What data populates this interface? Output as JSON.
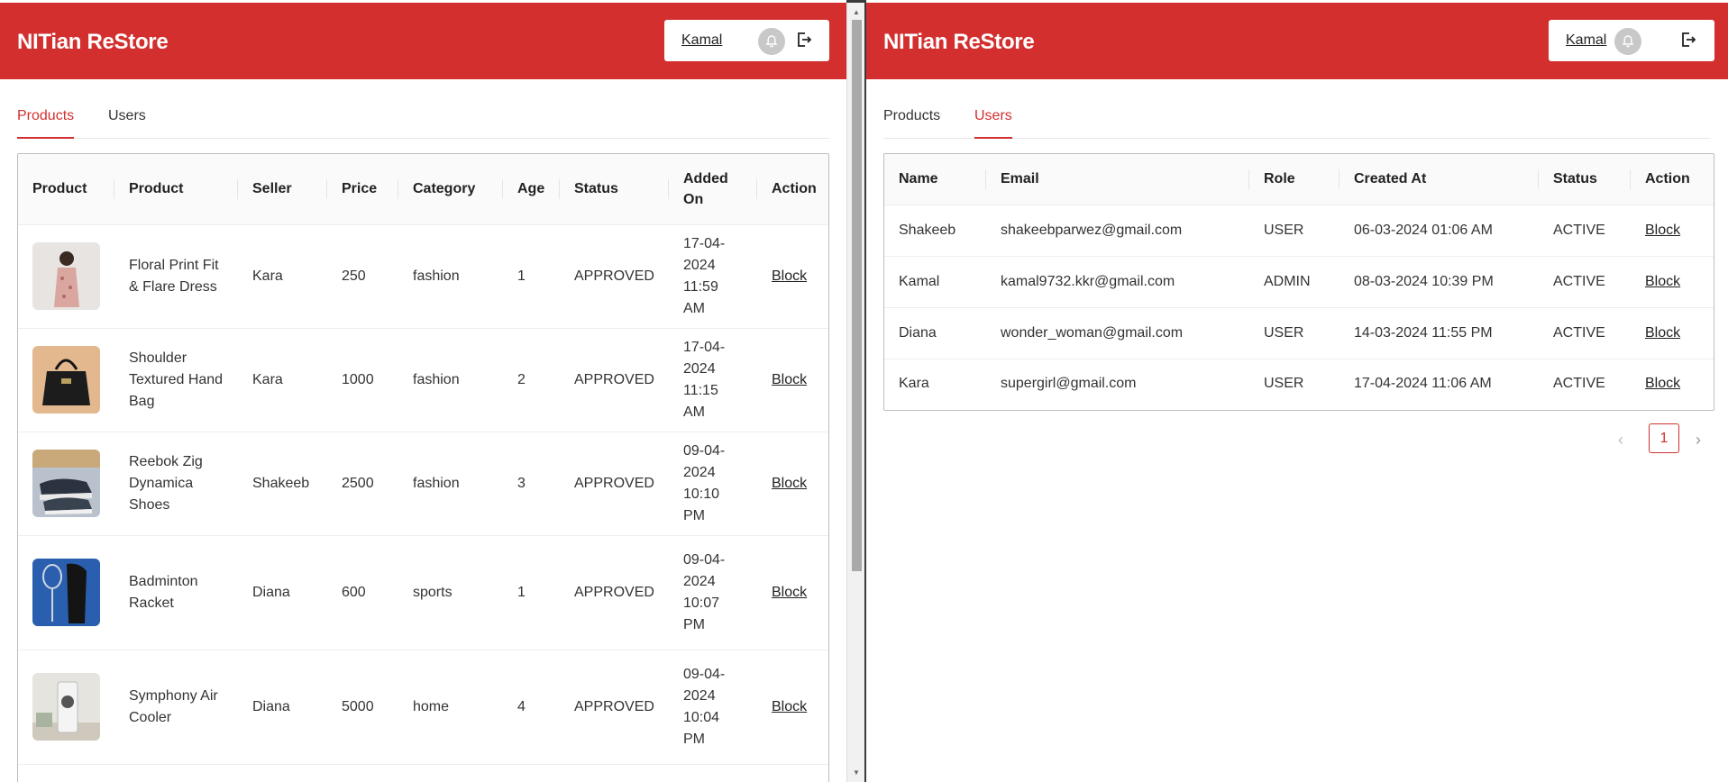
{
  "app": {
    "brand": "NITian ReStore",
    "user": "Kamal"
  },
  "tabs": [
    {
      "label": "Products"
    },
    {
      "label": "Users"
    }
  ],
  "products_table": {
    "headers": [
      "Product",
      "Product",
      "Seller",
      "Price",
      "Category",
      "Age",
      "Status",
      "Added On",
      "Action"
    ],
    "rows": [
      {
        "name": "Floral Print Fit & Flare Dress",
        "seller": "Kara",
        "price": "250",
        "category": "fashion",
        "age": "1",
        "status": "APPROVED",
        "added_on": "17-04-2024 11:59 AM",
        "action": "Block",
        "thumb": "dress-photo"
      },
      {
        "name": "Shoulder Textured Hand Bag",
        "seller": "Kara",
        "price": "1000",
        "category": "fashion",
        "age": "2",
        "status": "APPROVED",
        "added_on": "17-04-2024 11:15 AM",
        "action": "Block",
        "thumb": "handbag-photo"
      },
      {
        "name": "Reebok Zig Dynamica Shoes",
        "seller": "Shakeeb",
        "price": "2500",
        "category": "fashion",
        "age": "3",
        "status": "APPROVED",
        "added_on": "09-04-2024 10:10 PM",
        "action": "Block",
        "thumb": "shoes-photo"
      },
      {
        "name": "Badminton Racket",
        "seller": "Diana",
        "price": "600",
        "category": "sports",
        "age": "1",
        "status": "APPROVED",
        "added_on": "09-04-2024 10:07 PM",
        "action": "Block",
        "thumb": "racket-photo"
      },
      {
        "name": "Symphony Air Cooler",
        "seller": "Diana",
        "price": "5000",
        "category": "home",
        "age": "4",
        "status": "APPROVED",
        "added_on": "09-04-2024 10:04 PM",
        "action": "Block",
        "thumb": "cooler-photo"
      }
    ]
  },
  "users_table": {
    "headers": [
      "Name",
      "Email",
      "Role",
      "Created At",
      "Status",
      "Action"
    ],
    "rows": [
      {
        "name": "Shakeeb",
        "email": "shakeebparwez@gmail.com",
        "role": "USER",
        "created_at": "06-03-2024 01:06 AM",
        "status": "ACTIVE",
        "action": "Block"
      },
      {
        "name": "Kamal",
        "email": "kamal9732.kkr@gmail.com",
        "role": "ADMIN",
        "created_at": "08-03-2024 10:39 PM",
        "status": "ACTIVE",
        "action": "Block"
      },
      {
        "name": "Diana",
        "email": "wonder_woman@gmail.com",
        "role": "USER",
        "created_at": "14-03-2024 11:55 PM",
        "status": "ACTIVE",
        "action": "Block"
      },
      {
        "name": "Kara",
        "email": "supergirl@gmail.com",
        "role": "USER",
        "created_at": "17-04-2024 11:06 AM",
        "status": "ACTIVE",
        "action": "Block"
      }
    ]
  },
  "pagination": {
    "prev": "‹",
    "current": "1",
    "next": "›"
  },
  "colors": {
    "brand": "#d32f2f",
    "header_text": "#ffffff"
  },
  "icons": {
    "notification": "bell-icon",
    "logout": "logout-icon"
  }
}
